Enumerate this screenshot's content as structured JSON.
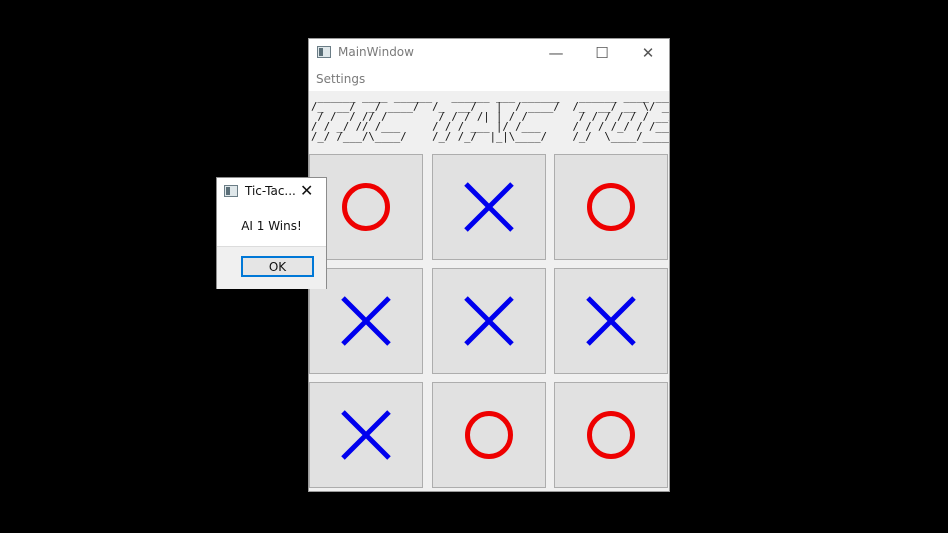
{
  "main_window": {
    "title": "MainWindow",
    "minimize_glyph": "—",
    "maximize_glyph": "☐",
    "close_glyph": "✕"
  },
  "menu": {
    "settings_label": "Settings"
  },
  "banner": {
    "ascii_art": " ______ ____ ______   ______ ___ ______   ______ ____ ______\n/_  __/  _/ ____/  /_  __/   |  / ____/  /_  __/ __ \\/ ____/\n / /  / // /        / / / /| | / /        / / / / / / __/\n/ / _/ // /___     / / / ___ |/ /___     / / / /_/ / /___\n/_/ /___/\\____/    /_/ /_/  |_|\\____/    /_/  \\____/_____/"
  },
  "board": {
    "cells": [
      "O",
      "X",
      "O",
      "X",
      "X",
      "X",
      "X",
      "O",
      "O"
    ],
    "colors": {
      "O": "#ee0000",
      "X": "#0000ee"
    }
  },
  "dialog": {
    "title": "Tic-Tac...",
    "close_glyph": "✕",
    "message": "AI 1 Wins!",
    "ok_label": "OK"
  }
}
